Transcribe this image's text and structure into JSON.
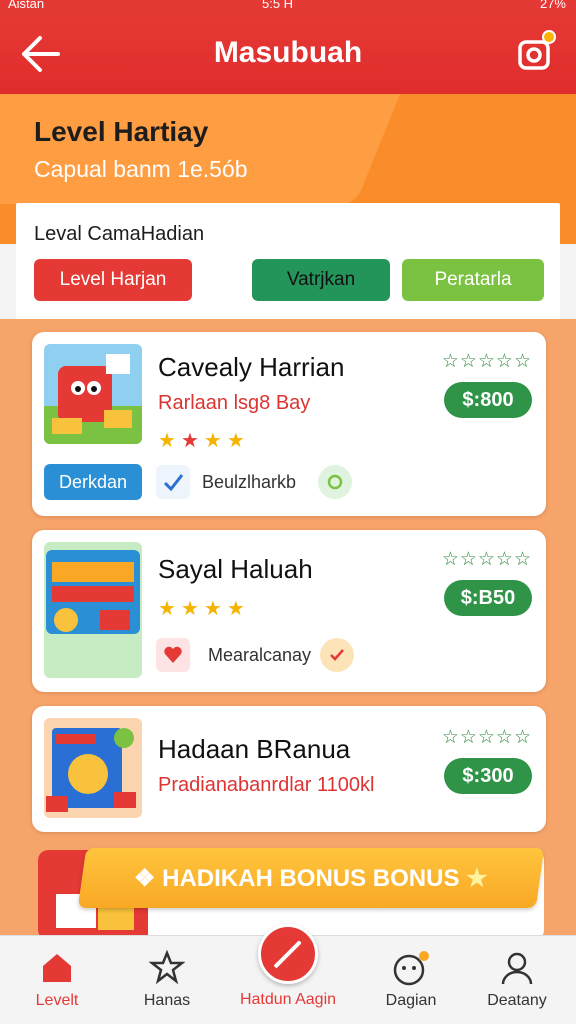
{
  "status_bar": {
    "carrier": "Aistan",
    "time": "5:5 H",
    "battery": "27%"
  },
  "app_bar": {
    "title": "Masubuah"
  },
  "hero": {
    "title": "Level Hartiay",
    "subtitle": "Capual banm 1e.5ób"
  },
  "panel": {
    "title": "Leval CamaHadian",
    "tabs": [
      {
        "label": "Level Harjan"
      },
      {
        "label": "Vatrjkan"
      },
      {
        "label": "Peratarla"
      }
    ]
  },
  "cards": [
    {
      "name": "Cavealy Harrian",
      "subtitle": "Rarlaan lsg8 Bay",
      "price": "$:800",
      "stars": "☆☆☆☆☆",
      "button_label": "Derkdan",
      "meta_label": "Beulzlharkb"
    },
    {
      "name": "Sayal Haluah",
      "price": "$:B50",
      "stars": "☆☆☆☆☆",
      "meta_label": "Mearalcanay"
    },
    {
      "name": "Hadaan BRanua",
      "subtitle": "Pradianabanrdlar 1100kl",
      "price": "$:300",
      "stars": "☆☆☆☆☆"
    }
  ],
  "bonus": {
    "label": "HADIKAH BONUS BONUS"
  },
  "bottom_nav": {
    "items": [
      {
        "label": "Levelt",
        "icon": "home-icon"
      },
      {
        "label": "Hanas",
        "icon": "star-icon"
      },
      {
        "label": "Hatdun Aagin",
        "icon": "pencil-icon"
      },
      {
        "label": "Dagian",
        "icon": "face-icon"
      },
      {
        "label": "Deatany",
        "icon": "user-icon"
      }
    ]
  },
  "colors": {
    "primary": "#e53935",
    "accent_orange": "#fb8c2a",
    "green": "#2f9447",
    "light_green": "#7cc242",
    "gold": "#f9a825"
  }
}
